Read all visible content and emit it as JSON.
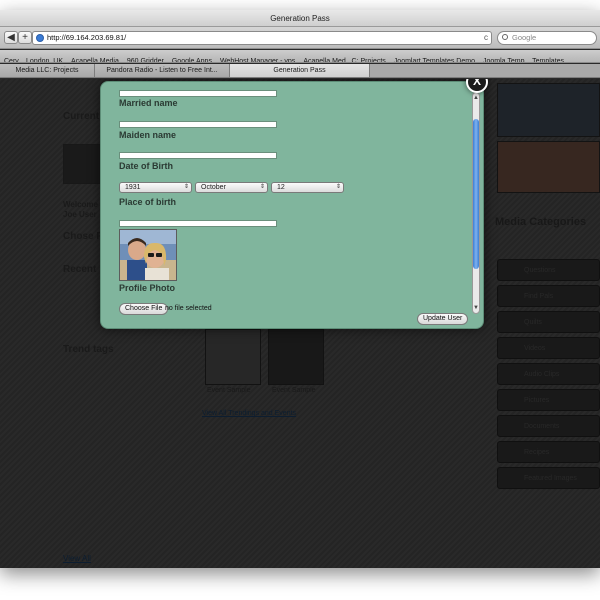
{
  "window": {
    "title": "Generation Pass"
  },
  "toolbar": {
    "back_label": "◀",
    "add_label": "+",
    "url": "http://69.164.203.69.81/",
    "reload_label": "c",
    "search_placeholder": "Google"
  },
  "bookmarks": [
    "Cerv... London, UK",
    "Acapella Media",
    "960 Gridder",
    "Google Apps",
    "WebHost Manager - vps",
    "Acapella Med...C: Projects",
    "Joomlart Templates Demo",
    "Joomla Temp... Templates"
  ],
  "tabs": [
    {
      "label": "Media LLC: Projects",
      "active": false
    },
    {
      "label": "Pandora Radio - Listen to Free Int...",
      "active": false
    },
    {
      "label": "Generation Pass",
      "active": true
    }
  ],
  "background": {
    "left": {
      "current_heading": "Current",
      "welcome_line1": "Welcome",
      "welcome_line2": "Joe User",
      "section_chose": "Chose F",
      "section_recent": "Recent",
      "trend_tags_heading": "Trend tags",
      "view_all_link": "View All"
    },
    "side": {
      "media_categories": "Media Categories",
      "buttons": [
        "Questions",
        "Find Pals",
        "Quilts",
        "Videos",
        "Audio Clips",
        "Pictures",
        "Documents",
        "Recipes",
        "Featured Images"
      ]
    },
    "thumbs": [
      {
        "caption": "Event Sample"
      },
      {
        "caption": "Event Sample"
      }
    ],
    "view_all_footer": "View All Trendings and Events"
  },
  "modal": {
    "close_label": "X",
    "fields": {
      "married_name_label": "Married name",
      "married_name_value": "",
      "maiden_name_label": "Maiden name",
      "maiden_name_value": "",
      "date_of_birth_label": "Date of Birth",
      "date_of_birth_value": "",
      "place_of_birth_label": "Place of birth",
      "place_of_birth_value": "",
      "profile_photo_label": "Profile Photo"
    },
    "dob_selects": {
      "year": "1931",
      "month": "October",
      "day": "12"
    },
    "choose_file_label": "Choose File",
    "no_file_text": "no file selected",
    "update_button_label": "Update User"
  },
  "colors": {
    "modal_bg": "#80b59d",
    "page_bg": "#2a2a2a",
    "scroll_thumb": "#3b7fd6"
  }
}
